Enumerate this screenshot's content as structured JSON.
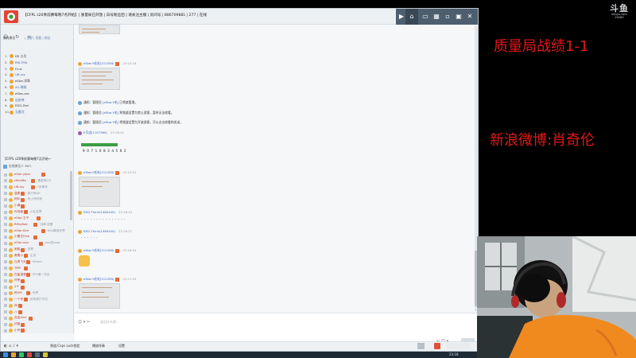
{
  "window": {
    "title": "【CFPL s20季前赛每晚7点开始】| 质量局已开放 | 白号粉丝团 | 请关注主播 | 房间号 | 886709881 | 277 | 在线",
    "tb_icons": [
      "play-icon",
      "home-icon",
      "gamepad-icon",
      "grid-icon",
      "minimize-icon",
      "restore-icon",
      "close-icon"
    ]
  },
  "left": {
    "header": "贵宾席位 ·",
    "tabs": "| 全部 | 观看 | 粉丝",
    "members": [
      {
        "idx": "1.",
        "name": "DS 小月"
      },
      {
        "idx": "2.",
        "name": "RW-TMA"
      },
      {
        "idx": "3.",
        "name": "Fcuz"
      },
      {
        "idx": "4.",
        "name": "UB.zzy"
      },
      {
        "idx": "5.",
        "name": "eStar-洋哥"
      },
      {
        "idx": "6.",
        "name": "AG-晓政"
      },
      {
        "idx": "7.",
        "name": "eStar-zza"
      },
      {
        "idx": "8.",
        "name": "自由神"
      },
      {
        "idx": "9.",
        "name": "EDG.Zed"
      },
      {
        "idx": "10.",
        "name": "无痕剑"
      }
    ],
    "room_title": "【CFPL s20季前赛每晚7点开始~",
    "room_count": "在线席位人 96人",
    "users": [
      {
        "name": "eStar-yaba",
        "sig": ""
      },
      {
        "name": "zKemBo",
        "sig": "·重量神之K"
      },
      {
        "name": "UB.zzy",
        "sig": "·UB零号"
      },
      {
        "name": "温柔",
        "sig": "·我只练AK"
      },
      {
        "name": "阿咔",
        "sig": "·玩小号时快"
      },
      {
        "name": "小满",
        "sig": ""
      },
      {
        "name": "叶鸡格",
        "sig": "·小队友帮"
      },
      {
        "name": "eStar-卫子",
        "sig": ""
      },
      {
        "name": "RHbyKob",
        "sig": "·战神 皮蛋"
      },
      {
        "name": "eStar-Kite",
        "sig": "·kite最强世界"
      },
      {
        "name": "小霸王Free",
        "sig": ""
      },
      {
        "name": "eStar-wyu",
        "sig": "·aaa皮Ipop"
      },
      {
        "name": "刺客",
        "sig": "·皮哥"
      },
      {
        "name": "黑鹰小",
        "sig": "·主流"
      },
      {
        "name": "白虎飞天",
        "sig": "·Steam"
      },
      {
        "name": "TMR",
        "sig": ""
      },
      {
        "name": "白鲨漫漫",
        "sig": "·SPS第一次见"
      },
      {
        "name": "许荣",
        "sig": ""
      },
      {
        "name": "小Y",
        "sig": ""
      },
      {
        "name": "阿VIR",
        "sig": "·世界"
      },
      {
        "name": "一个号",
        "sig": "·目前我打不过"
      },
      {
        "name": "邦",
        "sig": ""
      },
      {
        "name": "八",
        "sig": ""
      },
      {
        "name": "自由God",
        "sig": ""
      },
      {
        "name": "初爱",
        "sig": ""
      },
      {
        "name": "小号",
        "sig": ""
      }
    ]
  },
  "chat": {
    "messages": [
      {
        "name": "eStar.Y毛毛(212358)",
        "time": "23:15:16"
      },
      {
        "name": "eStar.Y毛毛(212358)",
        "time": "23:15:31"
      },
      {
        "name": "EDG.Thinh(1480440)",
        "time": "23:16:34"
      },
      {
        "name": "EDG.Thinh(1480440)",
        "time": "23:16:37"
      },
      {
        "name": "eStar.Y毛毛(212358)",
        "time": "23:16:54"
      },
      {
        "name": "eStar.Y毛毛(212358)",
        "time": "23:17:03"
      }
    ],
    "notices": [
      {
        "pre": "通知：管理员 ",
        "link": "[eStar.Y毛]",
        "post": " 已将某管理。"
      },
      {
        "pre": "通知：管理员 ",
        "link": "[eStar.Y毛]",
        "post": " 将频道设置为禁止游客，暂时无法收看。"
      },
      {
        "pre": "通知：管理员 ",
        "link": "[eStar.Y毛]",
        "post": " 将频道设置为开放游客，可以点击收看和发送。"
      }
    ],
    "gift_user": "E号战(1107360)",
    "gift_time": "23:16:20",
    "voucher_code": "9 0 7 1 0 8 3 4 5 6 2",
    "dots1": "· · · · · · · · · · · · · · ·",
    "dots2": "· · · · · ·"
  },
  "input": {
    "placeholder": "说点什么吧...",
    "tools": "☺ ▾ ✂",
    "right": "↵   ☺ ▾"
  },
  "status": {
    "items": [
      "频道:Caps Lock锁定",
      "播放伴奏",
      "设置"
    ]
  },
  "overlay": {
    "watermark_big": "斗鱼",
    "watermark_small": "douyu.com",
    "watermark_sub": "20260",
    "line1": "质量局战绩1-1",
    "line2": "新浪微博:肖奇伦"
  },
  "taskbar": {
    "clock": "23:18"
  }
}
